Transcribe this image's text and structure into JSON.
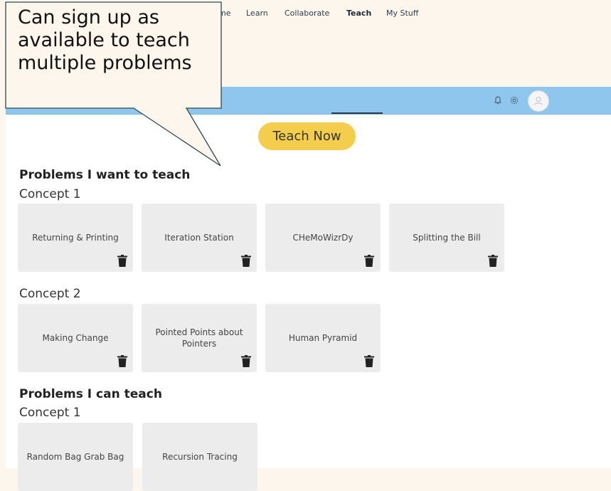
{
  "callout": {
    "text": "Can sign up as available to teach multiple problems"
  },
  "nav": {
    "items": [
      {
        "label": "me",
        "active": false
      },
      {
        "label": "Learn",
        "active": false
      },
      {
        "label": "Collaborate",
        "active": false
      },
      {
        "label": "Teach",
        "active": true
      },
      {
        "label": "My Stuff",
        "active": false
      }
    ],
    "icons": [
      "bell-icon",
      "gear-icon",
      "avatar-icon"
    ]
  },
  "teach_now": {
    "label": "Teach Now"
  },
  "want_section": {
    "title": "Problems I want to teach",
    "concepts": [
      {
        "name": "Concept 1",
        "problems": [
          "Returning & Printing",
          "Iteration Station",
          "CHeMoWizrDy",
          "Splitting the Bill"
        ]
      },
      {
        "name": "Concept 2",
        "problems": [
          "Making Change",
          "Pointed Points about Pointers",
          "Human Pyramid"
        ]
      }
    ]
  },
  "can_section": {
    "title": "Problems I can  teach",
    "concepts": [
      {
        "name": "Concept 1",
        "problems": [
          "Random Bag Grab Bag",
          "Recursion Tracing"
        ]
      }
    ]
  },
  "colors": {
    "navbar": "#8ec6ee",
    "teach_button": "#f3cd4b",
    "card": "#ececec",
    "callout_bg": "#fdf6ec"
  }
}
